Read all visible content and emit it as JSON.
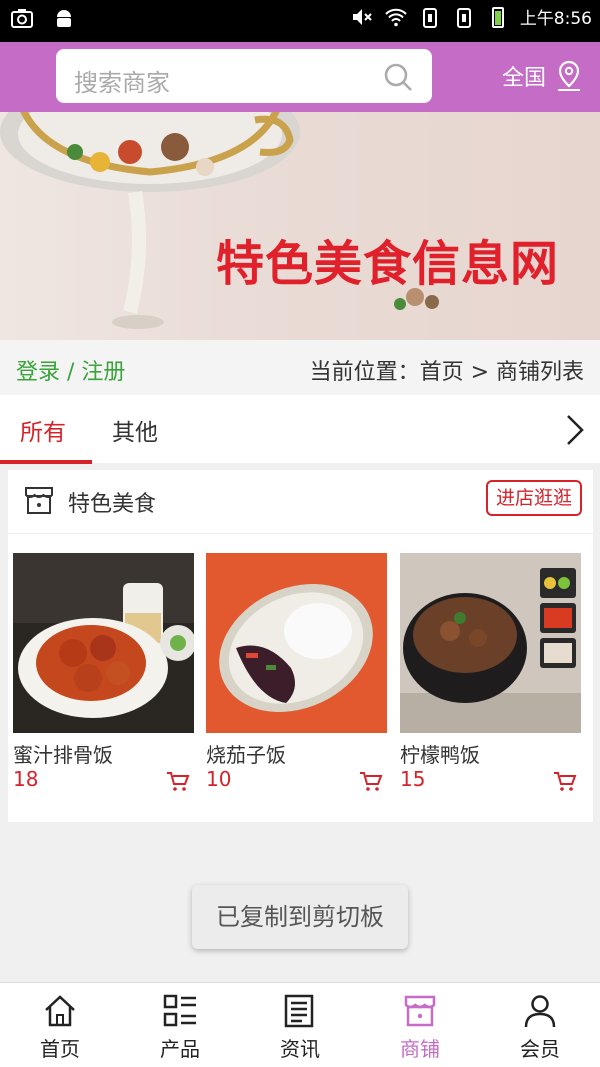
{
  "status_bar": {
    "time": "上午8:56"
  },
  "header": {
    "search_placeholder": "搜索商家",
    "region": "全国"
  },
  "banner": {
    "title": "特色美食信息网"
  },
  "location_bar": {
    "login": "登录 / 注册",
    "breadcrumb": "当前位置：首页 > 商铺列表"
  },
  "tabs": [
    {
      "label": "所有",
      "active": true
    },
    {
      "label": "其他",
      "active": false
    }
  ],
  "shop": {
    "name": "特色美食",
    "visit_label": "进店逛逛",
    "products": [
      {
        "name": "蜜汁排骨饭",
        "price": "18"
      },
      {
        "name": "烧茄子饭",
        "price": "10"
      },
      {
        "name": "柠檬鸭饭",
        "price": "15"
      }
    ]
  },
  "toast": "已复制到剪切板",
  "bottom_nav": [
    {
      "label": "首页",
      "icon": "home-icon"
    },
    {
      "label": "产品",
      "icon": "grid-list-icon"
    },
    {
      "label": "资讯",
      "icon": "news-icon"
    },
    {
      "label": "商铺",
      "icon": "shop-icon",
      "active": true
    },
    {
      "label": "会员",
      "icon": "user-icon"
    }
  ],
  "colors": {
    "theme": "#c56cc6",
    "accent": "#d6232a",
    "green": "#3aa33a"
  }
}
